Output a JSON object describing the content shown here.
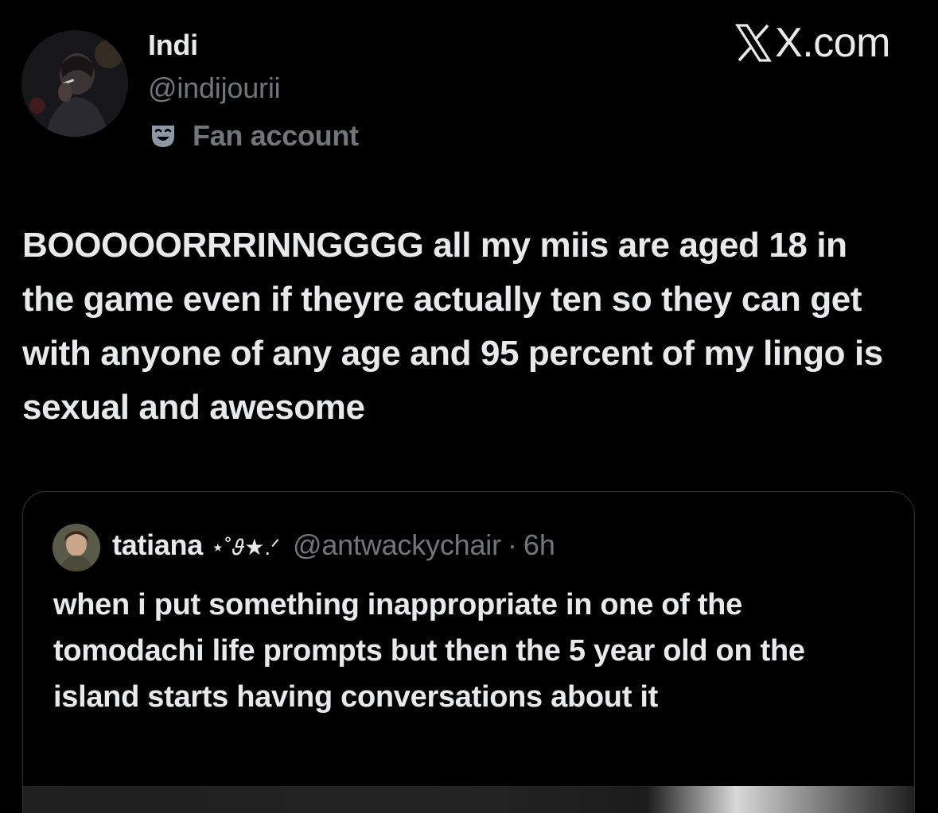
{
  "author": {
    "display_name": "Indi",
    "handle": "@indijourii",
    "label": "Fan account",
    "label_icon": "theater-mask-icon"
  },
  "watermark": {
    "text": "X.com",
    "logo_icon": "x-logo-icon"
  },
  "tweet": {
    "text": "BOOOOORRRINNGGGG all my miis are aged 18 in the game even if theyre actually ten so they can get with anyone of any age and 95 percent of my lingo is sexual and awesome"
  },
  "quoted_tweet": {
    "display_name": "tatiana",
    "name_decoration": "⋆˚𝜗★.ᐟ",
    "handle": "@antwackychair",
    "separator": "·",
    "time": "6h",
    "text": "when i put something inappropriate in one of the tomodachi life prompts but then the 5 year old on the island starts having conversations about it",
    "has_media": true
  },
  "colors": {
    "background": "#000000",
    "primary_text": "#e7e9ea",
    "secondary_text": "#71767b",
    "border": "#2f3336"
  }
}
